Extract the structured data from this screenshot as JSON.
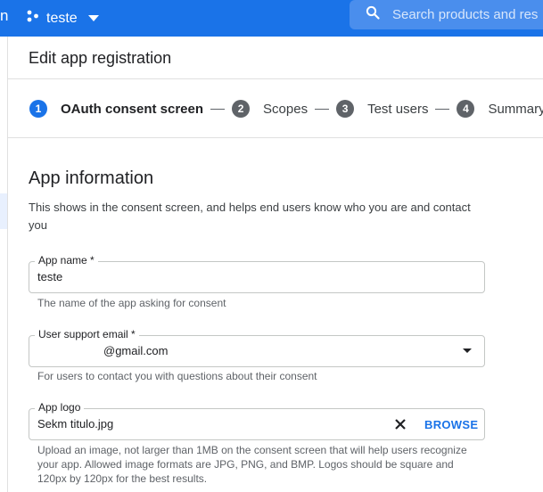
{
  "topbar": {
    "brand_fragment": "n",
    "project_name": "teste",
    "search_placeholder": "Search products and res"
  },
  "page": {
    "title": "Edit app registration"
  },
  "stepper": {
    "steps": [
      {
        "number": "1",
        "label": "OAuth consent screen",
        "active": true
      },
      {
        "number": "2",
        "label": "Scopes",
        "active": false
      },
      {
        "number": "3",
        "label": "Test users",
        "active": false
      },
      {
        "number": "4",
        "label": "Summary",
        "active": false
      }
    ]
  },
  "section": {
    "title": "App information",
    "description": "This shows in the consent screen, and helps end users know who you are and contact you"
  },
  "fields": {
    "app_name": {
      "label": "App name *",
      "value": "teste",
      "hint": "The name of the app asking for consent"
    },
    "support_email": {
      "label": "User support email *",
      "value": "@gmail.com",
      "hint": "For users to contact you with questions about their consent"
    },
    "app_logo": {
      "label": "App logo",
      "value": "Sekm titulo.jpg",
      "browse_label": "BROWSE",
      "hint_line1": "Upload an image, not larger than 1MB on the consent screen that will help users recognize",
      "hint_line2": "your app. Allowed image formats are JPG, PNG, and BMP. Logos should be square and",
      "hint_line3": "120px by 120px for the best results."
    }
  },
  "colors": {
    "brand_blue": "#1a73e8",
    "step_gray": "#5f6368",
    "border": "#c4c7c5"
  },
  "icons": [
    "project-dots-icon",
    "chevron-down-icon",
    "search-icon",
    "close-icon",
    "dropdown-arrow-icon"
  ]
}
